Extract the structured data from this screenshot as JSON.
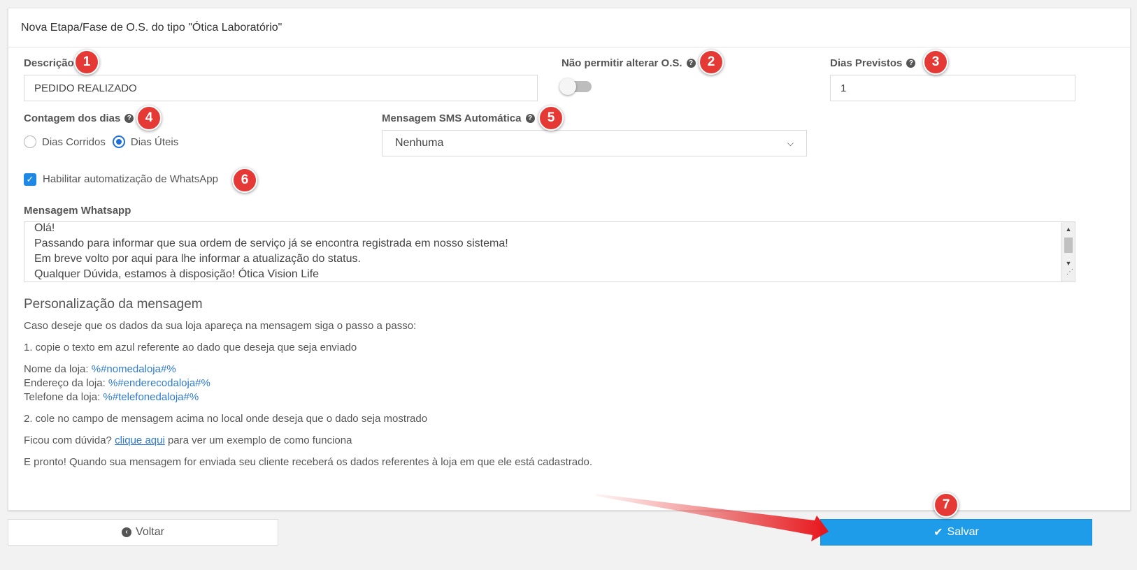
{
  "header": {
    "title": "Nova Etapa/Fase de O.S. do tipo \"Ótica Laboratório\""
  },
  "descricao": {
    "label": "Descrição",
    "value": "PEDIDO REALIZADO"
  },
  "nao_permitir": {
    "label": "Não permitir alterar O.S.",
    "enabled": false
  },
  "dias_previstos": {
    "label": "Dias Previstos",
    "value": "1"
  },
  "contagem": {
    "label": "Contagem dos dias",
    "options": [
      "Dias Corridos",
      "Dias Úteis"
    ],
    "selected": "Dias Úteis"
  },
  "sms": {
    "label": "Mensagem SMS Automática",
    "selected": "Nenhuma"
  },
  "whatsapp_toggle": {
    "label": "Habilitar automatização de WhatsApp",
    "checked": true
  },
  "mensagem": {
    "label": "Mensagem Whatsapp",
    "lines": [
      "Olá!",
      "Passando para informar que sua ordem de serviço já se encontra registrada em nosso sistema!",
      "Em breve volto por aqui para lhe informar a atualização do status.",
      "Qualquer Dúvida, estamos à disposição! Ótica Vision Life"
    ]
  },
  "personalizacao": {
    "title": "Personalização da mensagem",
    "intro": "Caso deseje que os dados da sua loja apareça na mensagem siga o passo a passo:",
    "step1": "1. copie o texto em azul referente ao dado que deseja que seja enviado",
    "vars": [
      {
        "label": "Nome da loja:",
        "token": "%#nomedaloja#%"
      },
      {
        "label": "Endereço da loja:",
        "token": "%#enderecodaloja#%"
      },
      {
        "label": "Telefone da loja:",
        "token": "%#telefonedaloja#%"
      }
    ],
    "step2": "2. cole no campo de mensagem acima no local onde deseja que o dado seja mostrado",
    "duvida_pre": "Ficou com dúvida?",
    "duvida_link": "clique aqui",
    "duvida_post": "para ver um exemplo de como funciona",
    "final": "E pronto! Quando sua mensagem for enviada seu cliente receberá os dados referentes à loja em que ele está cadastrado."
  },
  "buttons": {
    "back": "Voltar",
    "save": "Salvar"
  },
  "badges": [
    "1",
    "2",
    "3",
    "4",
    "5",
    "6",
    "7"
  ],
  "colors": {
    "accent": "#1e9be9",
    "badge": "#e53935",
    "link": "#2d7bd3"
  },
  "icons": {
    "help": "question-circle-icon",
    "back": "arrow-circle-left-icon",
    "save": "check-icon"
  }
}
